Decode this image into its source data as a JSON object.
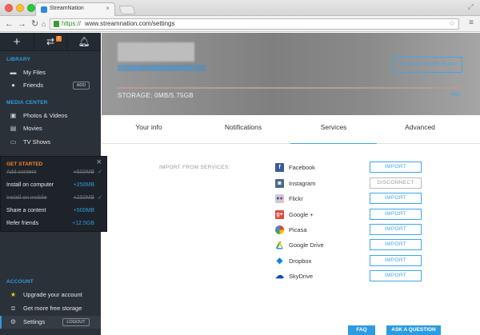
{
  "browser": {
    "tab_title": "StreamNation",
    "url_scheme": "https://",
    "url_rest": "www.streamnation.com/settings"
  },
  "sidebar": {
    "library_label": "LIBRARY",
    "my_files": "My Files",
    "friends": "Friends",
    "add_label": "ADD",
    "media_center_label": "MEDIA CENTER",
    "photos_videos": "Photos & Videos",
    "movies": "Movies",
    "tv_shows": "TV Shows",
    "account_label": "ACCOUNT",
    "upgrade": "Upgrade your account",
    "free_storage": "Get more free storage",
    "settings": "Settings",
    "logout_label": "LOGOUT",
    "notif_badge": "1"
  },
  "get_started": {
    "title": "GET STARTED",
    "items": [
      {
        "label": "Add content",
        "value": "+500MB",
        "done": true
      },
      {
        "label": "Install on computer",
        "value": "+250MB",
        "done": false
      },
      {
        "label": "Install on mobile",
        "value": "+250MB",
        "done": true
      },
      {
        "label": "Share a content",
        "value": "+500MB",
        "done": false
      },
      {
        "label": "Refer friends",
        "value": "+12.5GB",
        "done": false
      }
    ]
  },
  "header": {
    "plan_link": "Free plan - Compare the plans",
    "change_plan": "CHANGE YOUR PLAN",
    "storage": "STORAGE: 0MB/5.75GB",
    "storage_used_fraction": 0.0,
    "storage_link": "info"
  },
  "tabs": [
    "Your info",
    "Notifications",
    "Services",
    "Advanced"
  ],
  "active_tab": "Services",
  "services": {
    "section_label": "IMPORT FROM SERVICES:",
    "items": [
      {
        "name": "Facebook",
        "action": "IMPORT",
        "icon": "facebook-icon",
        "color": "#3b5998"
      },
      {
        "name": "Instagram",
        "action": "DISCONNECT",
        "icon": "instagram-icon",
        "color": "#4a6b8a"
      },
      {
        "name": "Flickr",
        "action": "IMPORT",
        "icon": "flickr-icon",
        "color": "#cccccc"
      },
      {
        "name": "Google +",
        "action": "IMPORT",
        "icon": "google-plus-icon",
        "color": "#dd4b39"
      },
      {
        "name": "Picasa",
        "action": "IMPORT",
        "icon": "picasa-icon",
        "color": "#e8e8e8"
      },
      {
        "name": "Google Drive",
        "action": "IMPORT",
        "icon": "google-drive-icon",
        "color": "#f4c20d"
      },
      {
        "name": "Dropbox",
        "action": "IMPORT",
        "icon": "dropbox-icon",
        "color": "#007ee5"
      },
      {
        "name": "SkyDrive",
        "action": "IMPORT",
        "icon": "skydrive-icon",
        "color": "#094ab2"
      }
    ]
  },
  "footer": {
    "faq": "FAQ",
    "ask": "ASK A QUESTION"
  }
}
